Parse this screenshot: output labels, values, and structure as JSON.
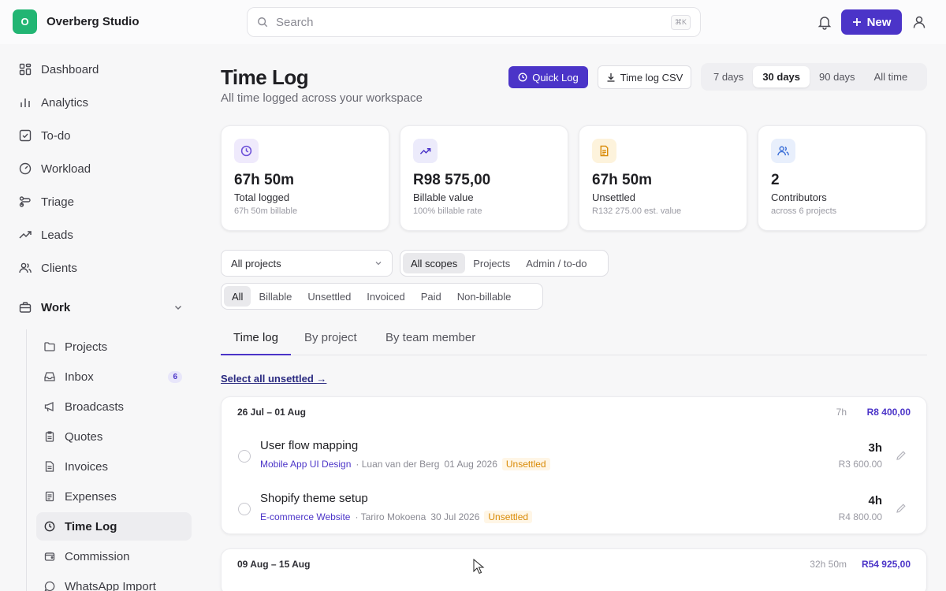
{
  "brand": {
    "logo_letter": "O",
    "name": "Overberg Studio",
    "logo_color": "#22b573"
  },
  "search": {
    "placeholder": "Search",
    "shortcut": "⌘K"
  },
  "header": {
    "new_label": "New"
  },
  "sidebar": {
    "items": [
      {
        "label": "Dashboard",
        "icon": "grid-icon"
      },
      {
        "label": "Analytics",
        "icon": "bar-chart-icon"
      },
      {
        "label": "To-do",
        "icon": "checkbox-icon"
      },
      {
        "label": "Workload",
        "icon": "gauge-icon"
      },
      {
        "label": "Triage",
        "icon": "triage-icon"
      },
      {
        "label": "Leads",
        "icon": "trend-icon"
      },
      {
        "label": "Clients",
        "icon": "users-icon"
      }
    ],
    "work": {
      "label": "Work",
      "items": [
        {
          "label": "Projects",
          "icon": "folder-icon"
        },
        {
          "label": "Inbox",
          "icon": "inbox-icon",
          "badge": "6"
        },
        {
          "label": "Broadcasts",
          "icon": "megaphone-icon"
        },
        {
          "label": "Quotes",
          "icon": "clipboard-icon"
        },
        {
          "label": "Invoices",
          "icon": "file-icon"
        },
        {
          "label": "Expenses",
          "icon": "receipt-icon"
        },
        {
          "label": "Time Log",
          "icon": "clock-icon",
          "active": true
        },
        {
          "label": "Commission",
          "icon": "wallet-icon"
        },
        {
          "label": "WhatsApp Import",
          "icon": "chat-icon"
        }
      ]
    }
  },
  "page": {
    "title": "Time Log",
    "subtitle": "All time logged across your workspace",
    "quick_log": "Quick Log",
    "csv": "Time log CSV",
    "ranges": [
      "7 days",
      "30 days",
      "90 days",
      "All time"
    ],
    "active_range": "30 days"
  },
  "stats": [
    {
      "value": "67h 50m",
      "label": "Total logged",
      "sub": "67h 50m billable",
      "icon": "clock-icon",
      "color": "#6b4fd8",
      "bg": "#efeafc"
    },
    {
      "value": "R98 575,00",
      "label": "Billable value",
      "sub": "100% billable rate",
      "icon": "trend-up-icon",
      "color": "#4b34c8",
      "bg": "#ecebfb"
    },
    {
      "value": "67h 50m",
      "label": "Unsettled",
      "sub": "R132 275.00 est. value",
      "icon": "document-icon",
      "color": "#d98a06",
      "bg": "#fdf3dc"
    },
    {
      "value": "2",
      "label": "Contributors",
      "sub": "across 6 projects",
      "icon": "users-icon",
      "color": "#3b6fd8",
      "bg": "#e8effc"
    }
  ],
  "filters": {
    "project": "All projects",
    "scopes": [
      "All scopes",
      "Projects",
      "Admin / to-do"
    ],
    "statuses": [
      "All",
      "Billable",
      "Unsettled",
      "Invoiced",
      "Paid",
      "Non-billable"
    ]
  },
  "tabs": [
    "Time log",
    "By project",
    "By team member"
  ],
  "select_link": "Select all unsettled →",
  "weeks": [
    {
      "range": "26 Jul – 01 Aug",
      "hours": "7h",
      "total": "R8 400,00",
      "entries": [
        {
          "title": "User flow mapping",
          "project": "Mobile App UI Design",
          "member": "· Luan van der Berg",
          "date": "01 Aug 2026",
          "status": "Unsettled",
          "hours": "3h",
          "amount": "R3 600.00"
        },
        {
          "title": "Shopify theme setup",
          "project": "E-commerce Website",
          "member": "· Tariro Mokoena",
          "date": "30 Jul 2026",
          "status": "Unsettled",
          "hours": "4h",
          "amount": "R4 800.00"
        }
      ]
    },
    {
      "range": "09 Aug – 15 Aug",
      "hours": "32h 50m",
      "total": "R54 925,00",
      "entries": []
    }
  ]
}
